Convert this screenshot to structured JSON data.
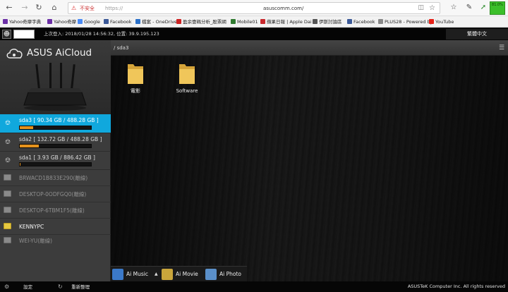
{
  "browser": {
    "security_warning": "不安全",
    "url_scheme": "https://",
    "url": "asuscomm.com/",
    "battery": "81.0%"
  },
  "bookmarks": [
    {
      "label": "Yahoo奇摩字典",
      "color": "#6b2fa6"
    },
    {
      "label": "Yahoo奇摩",
      "color": "#6b2fa6"
    },
    {
      "label": "Google",
      "color": "#4a8af4"
    },
    {
      "label": "Facebook",
      "color": "#3b5998"
    },
    {
      "label": "檔案 - OneDrive",
      "color": "#2a70c8"
    },
    {
      "label": "盈余壹碼分析_股票網",
      "color": "#cc2222"
    },
    {
      "label": "Mobile01",
      "color": "#2f7a2f"
    },
    {
      "label": "蘋果日報 | Apple Dai",
      "color": "#c8282c"
    },
    {
      "label": "伊斯討論區",
      "color": "#555555"
    },
    {
      "label": "Facebook",
      "color": "#3b5998"
    },
    {
      "label": "PLUS28 - Powered by",
      "color": "#888888"
    },
    {
      "label": "YouTube",
      "color": "#e62117"
    }
  ],
  "topbar": {
    "last_login": "上次登入: 2018/01/28 14:56:32, 位置: 39.9.195.123",
    "language": "繁體中文"
  },
  "sidebar": {
    "logo_text": "ASUS AiCloud",
    "drives": [
      {
        "label": "sda3 [ 90.34 GB / 488.28 GB ]",
        "usage": 0.185,
        "active": true
      },
      {
        "label": "sda2 [ 132.72 GB / 488.28 GB ]",
        "usage": 0.27,
        "active": false
      },
      {
        "label": "sda1 [ 3.93 GB / 886.42 GB ]",
        "usage": 0.005,
        "active": false
      }
    ],
    "computers": [
      {
        "name": "BRWACD1B833E290(離線)",
        "online": false
      },
      {
        "name": "DESKTOP-0ODFGQ0(離線)",
        "online": false
      },
      {
        "name": "DESKTOP-6TBM1F5(離線)",
        "online": false
      },
      {
        "name": "KENNYPC",
        "online": true
      },
      {
        "name": "WEI-YU(離線)",
        "online": false
      }
    ]
  },
  "main": {
    "breadcrumb": "/ sda3",
    "folders": [
      "電影",
      "Software"
    ]
  },
  "media": [
    {
      "label": "Ai Music",
      "color": "#3b79c9"
    },
    {
      "label": "Ai Movie",
      "color": "#c9a53b"
    },
    {
      "label": "Ai Photo",
      "color": "#5a8fc9"
    }
  ],
  "bottom": {
    "settings": "設定",
    "refresh": "重新整理",
    "copyright": "ASUSTeK Computer Inc. All rights reserved"
  }
}
